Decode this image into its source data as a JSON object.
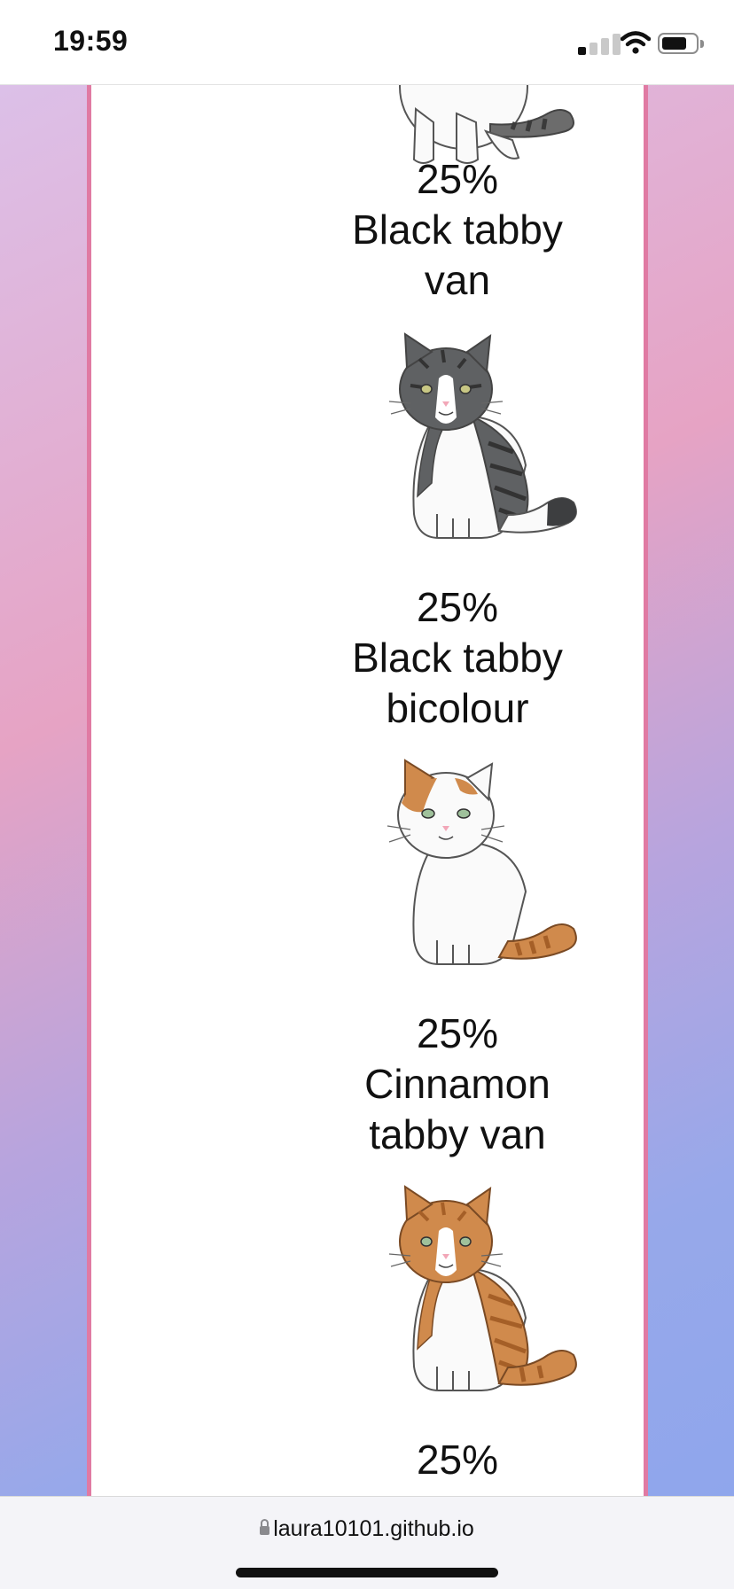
{
  "status_bar": {
    "time": "19:59",
    "signal_bars_on": 1,
    "battery_level": 0.75
  },
  "results": [
    {
      "percent": "25%",
      "name_lines": [
        "Black tabby",
        "van"
      ]
    },
    {
      "percent": "25%",
      "name_lines": [
        "Black tabby",
        "bicolour"
      ]
    },
    {
      "percent": "25%",
      "name_lines": [
        "Cinnamon",
        "tabby van"
      ]
    },
    {
      "percent": "25%",
      "name_lines": []
    }
  ],
  "cat_images": [
    {
      "icon": "black-tabby-van-cat-icon",
      "coat_color": "#6c6c6c",
      "coverage": "van"
    },
    {
      "icon": "black-tabby-bicolour-cat-icon",
      "coat_color": "#5f6163",
      "coverage": "bicolour"
    },
    {
      "icon": "cinnamon-tabby-van-cat-icon",
      "coat_color": "#d08a4c",
      "coverage": "van"
    },
    {
      "icon": "cinnamon-tabby-bicolour-cat-icon",
      "coat_color": "#d08a4c",
      "coverage": "bicolour"
    }
  ],
  "colors": {
    "card_border": "#e07aa3",
    "background_start": "#dcc0e8",
    "background_end": "#8fa6ec"
  },
  "browser": {
    "url": "laura10101.github.io"
  }
}
